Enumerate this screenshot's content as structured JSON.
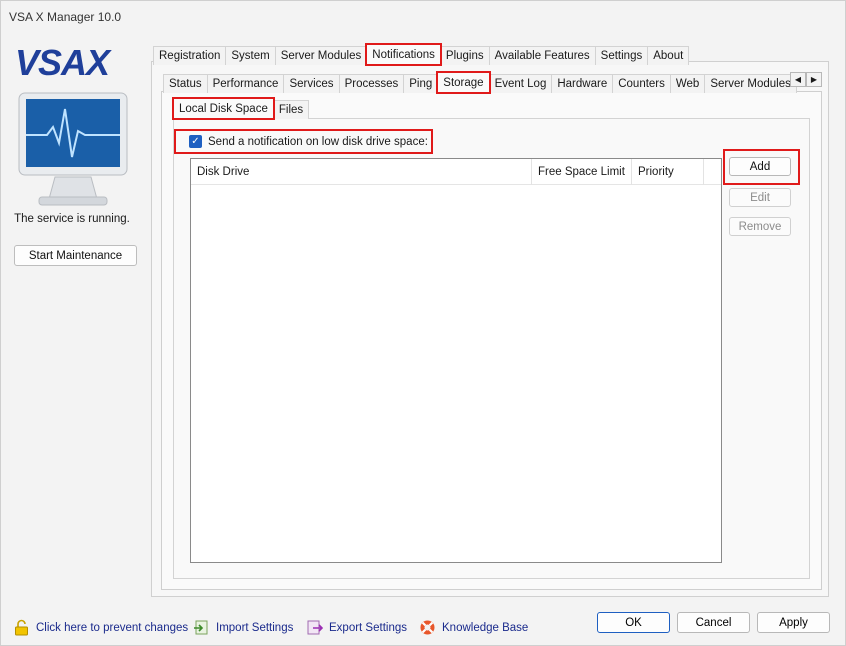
{
  "window": {
    "title": "VSA X Manager 10.0"
  },
  "left": {
    "logo_text": "VSAX",
    "status": "The service is running.",
    "maintenance_button": "Start Maintenance"
  },
  "tabs_top": [
    "Registration",
    "System",
    "Server Modules",
    "Notifications",
    "Plugins",
    "Available Features",
    "Settings",
    "About"
  ],
  "tabs_second": [
    "Status",
    "Performance",
    "Services",
    "Processes",
    "Ping",
    "Storage",
    "Event Log",
    "Hardware",
    "Counters",
    "Web",
    "Server Modules"
  ],
  "tabs_third": [
    "Local Disk Space",
    "Files"
  ],
  "storage": {
    "checkbox_label": "Send a notification on low disk drive space:",
    "columns": [
      "Disk Drive",
      "Free Space Limit",
      "Priority"
    ],
    "buttons": {
      "add": "Add",
      "edit": "Edit",
      "remove": "Remove"
    }
  },
  "footer": {
    "lock_link": "Click here to prevent changes",
    "import": "Import Settings",
    "export": "Export Settings",
    "kb": "Knowledge Base",
    "ok": "OK",
    "cancel": "Cancel",
    "apply": "Apply"
  },
  "colors": {
    "highlight": "#e01a1a",
    "accent": "#1e5fc1",
    "logo_blue": "#1f3f9a"
  }
}
